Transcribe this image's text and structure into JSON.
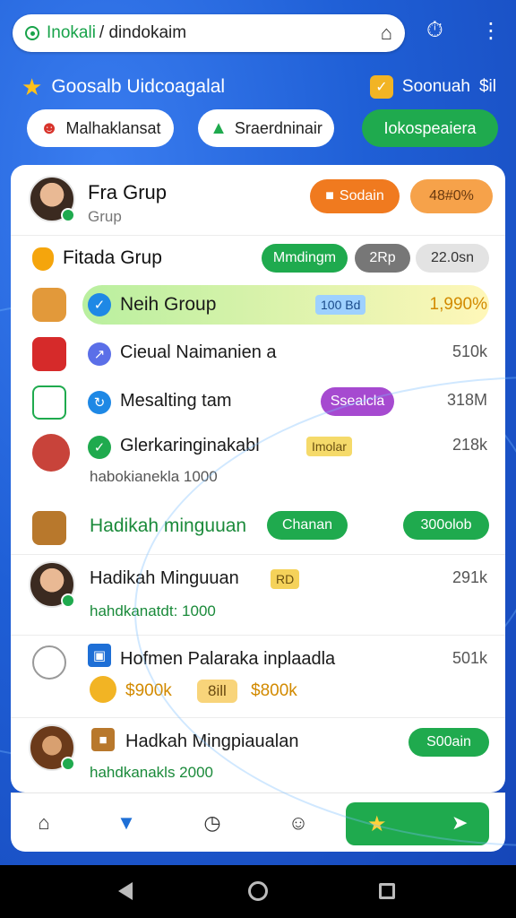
{
  "browser": {
    "url_host": "Inokali",
    "url_path": "/ dindokaim"
  },
  "header": {
    "title": "Goosalb Uidcoagalal",
    "right_label": "Soonuah",
    "right_suffix": "$il"
  },
  "pills": [
    {
      "label": "Malhaklansat",
      "icon": "person-icon"
    },
    {
      "label": "Sraerdninair",
      "icon": "mountain-icon"
    },
    {
      "label": "Iokospeaiera",
      "icon": ""
    }
  ],
  "group": {
    "name": "Fra Grup",
    "subtitle": "Grup",
    "button_primary": "Sodain",
    "button_secondary": "48#0%"
  },
  "section": {
    "title": "Fitada Grup",
    "tags": [
      "Mmdingm",
      "2Rp",
      "22.0sn"
    ]
  },
  "rows": [
    {
      "label": "Neih Group",
      "badge": "100 Bd",
      "value": "1,990%",
      "highlight": true
    },
    {
      "label": "Cieual Naimanien a",
      "value": "510k"
    },
    {
      "label": "Mesalting tam",
      "badge": "Ssealcla",
      "value": "318M"
    },
    {
      "label": "Glerkaringinakabl",
      "badge": "Imolar",
      "value": "218k",
      "sub": "habokianekla 1000"
    },
    {
      "label": "Hadikah minguuan",
      "badge": "Chanan",
      "value": "300olob"
    },
    {
      "label": "Hadikah Minguuan",
      "badge": "RD",
      "value": "291k",
      "sub": "hahdkanatdt: 1000"
    },
    {
      "label": "Hofmen Palaraka inplaadla",
      "value": "501k",
      "prices": [
        "$900k",
        "$800k"
      ],
      "price_chip": "8ill"
    },
    {
      "label": "Hadkah Mingpiaualan",
      "badge": "S00ain",
      "sub": "hahdkanakls 2000"
    }
  ]
}
